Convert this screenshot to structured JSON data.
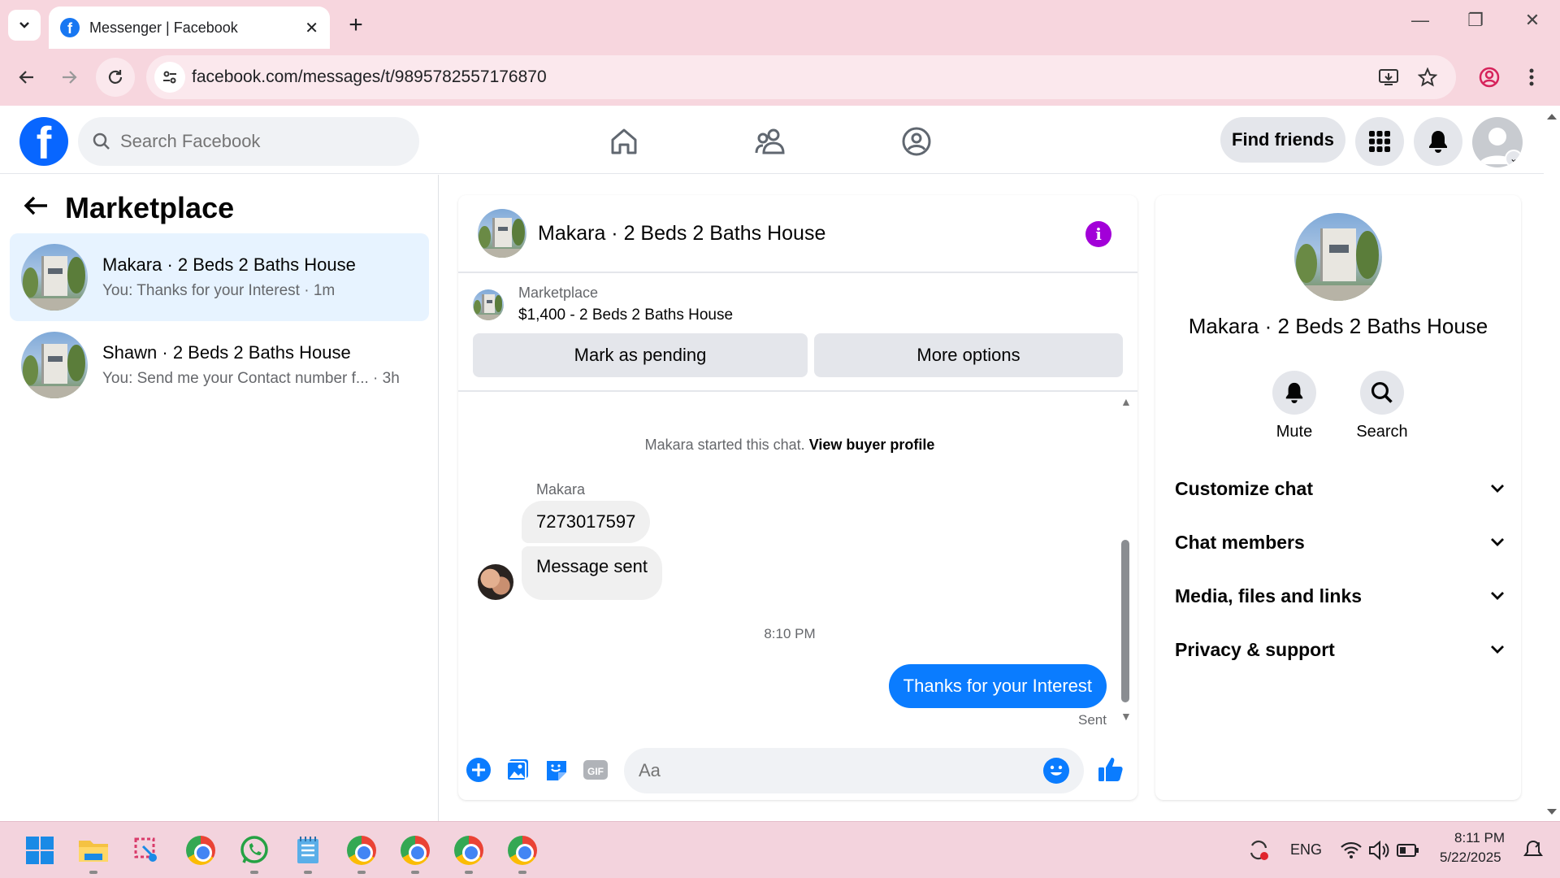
{
  "browser": {
    "tab_title": "Messenger | Facebook",
    "url": "facebook.com/messages/t/9895782557176870"
  },
  "fb": {
    "search_placeholder": "Search Facebook",
    "find_friends": "Find friends"
  },
  "sidebar": {
    "title": "Marketplace",
    "conversations": [
      {
        "name": "Makara · 2 Beds 2 Baths House",
        "preview": "You: Thanks for your Interest",
        "time": "1m",
        "active": true
      },
      {
        "name": "Shawn · 2 Beds 2 Baths House",
        "preview": "You: Send me your Contact number f...",
        "time": "3h",
        "active": false
      }
    ]
  },
  "chat": {
    "title": "Makara · 2 Beds 2 Baths House",
    "listing_source": "Marketplace",
    "listing": "$1,400 - 2 Beds 2 Baths House",
    "mark_pending": "Mark as pending",
    "more_options": "More options",
    "started_text": "Makara started this chat.",
    "view_profile": "View buyer profile",
    "sender_name": "Makara",
    "incoming": [
      "7273017597",
      "Message sent"
    ],
    "timestamp": "8:10 PM",
    "outgoing": "Thanks for your Interest",
    "status": "Sent",
    "composer_placeholder": "Aa"
  },
  "details": {
    "title": "Makara · 2 Beds 2 Baths House",
    "mute": "Mute",
    "search": "Search",
    "sections": [
      "Customize chat",
      "Chat members",
      "Media, files and links",
      "Privacy & support"
    ]
  },
  "taskbar": {
    "lang": "ENG",
    "time": "8:11 PM",
    "date": "5/22/2025"
  },
  "colors": {
    "fb_blue": "#0866ff",
    "bubble_out": "#0a7cff",
    "info_purple": "#a200d8",
    "active_conv": "#e7f3ff"
  }
}
